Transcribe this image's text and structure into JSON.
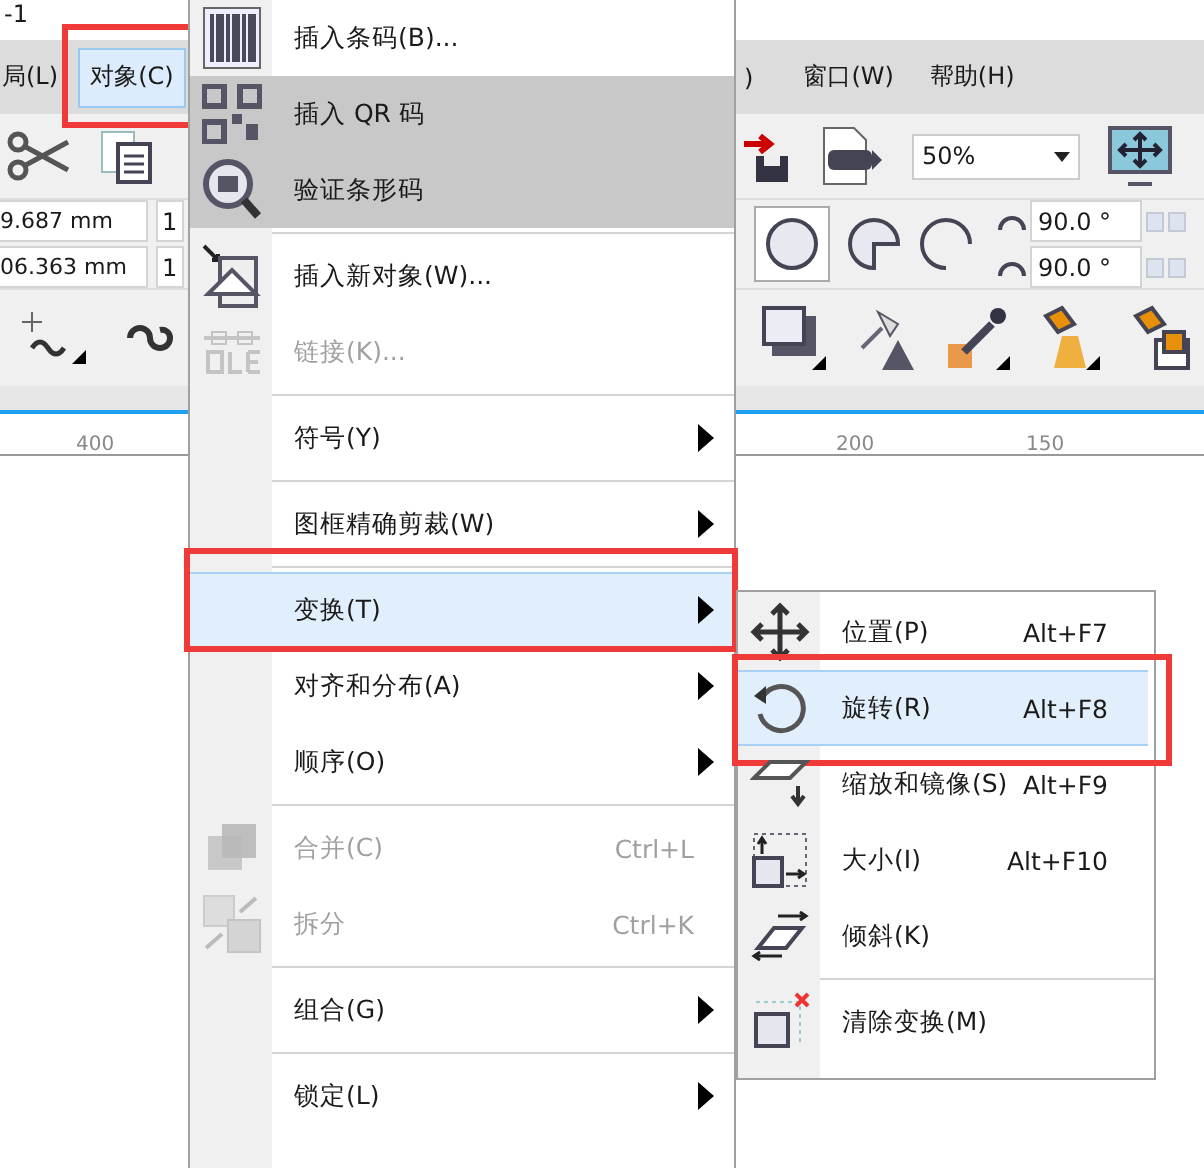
{
  "window": {
    "title": "-1"
  },
  "menubar": {
    "left": [
      {
        "label": "局(L)",
        "selected": false,
        "marked": false
      },
      {
        "label": "对象(C)",
        "selected": true,
        "marked": true
      }
    ],
    "right": [
      {
        "label": ")",
        "selected": false,
        "marked": false
      },
      {
        "label": "窗口(W)",
        "selected": false,
        "marked": false
      },
      {
        "label": "帮助(H)",
        "selected": false,
        "marked": false
      }
    ]
  },
  "toolbar": {
    "zoom": "50%"
  },
  "property_bar": {
    "x_field": "9.687 mm",
    "y_field": "06.363 mm",
    "field_3": "1",
    "field_4": "1",
    "angles": [
      "90.0 °",
      "90.0 °"
    ]
  },
  "ruler": {
    "labels": [
      "400",
      "200",
      "150"
    ]
  },
  "menu": {
    "items": [
      {
        "kind": "item",
        "label": "插入条码(B)...",
        "shaded": false,
        "selected": false,
        "disabled": false,
        "marked": false
      },
      {
        "kind": "item",
        "label": "插入 QR 码",
        "shaded": true,
        "selected": false,
        "disabled": false,
        "marked": false
      },
      {
        "kind": "item",
        "label": "验证条形码",
        "shaded": true,
        "selected": false,
        "disabled": false,
        "marked": false
      },
      {
        "kind": "separator"
      },
      {
        "kind": "item",
        "label": "插入新对象(W)...",
        "shaded": false,
        "selected": false,
        "disabled": false,
        "marked": false
      },
      {
        "kind": "item",
        "label": "链接(K)...",
        "shaded": false,
        "selected": false,
        "disabled": true,
        "marked": false
      },
      {
        "kind": "separator"
      },
      {
        "kind": "submenu",
        "label": "符号(Y)",
        "shaded": false,
        "selected": false,
        "disabled": false,
        "marked": false
      },
      {
        "kind": "separator"
      },
      {
        "kind": "submenu",
        "label": "图框精确剪裁(W)",
        "shaded": false,
        "selected": false,
        "disabled": false,
        "marked": false
      },
      {
        "kind": "separator"
      },
      {
        "kind": "submenu",
        "label": "变换(T)",
        "shaded": false,
        "selected": true,
        "disabled": false,
        "marked": true
      },
      {
        "kind": "submenu",
        "label": "对齐和分布(A)",
        "shaded": false,
        "selected": false,
        "disabled": false,
        "marked": false
      },
      {
        "kind": "submenu",
        "label": "顺序(O)",
        "shaded": false,
        "selected": false,
        "disabled": false,
        "marked": false
      },
      {
        "kind": "separator"
      },
      {
        "kind": "item",
        "label": "合并(C)",
        "shortcut": "Ctrl+L",
        "shaded": false,
        "selected": false,
        "disabled": true,
        "marked": false
      },
      {
        "kind": "item",
        "label": "拆分",
        "shortcut": "Ctrl+K",
        "shaded": false,
        "selected": false,
        "disabled": true,
        "marked": false
      },
      {
        "kind": "separator"
      },
      {
        "kind": "submenu",
        "label": "组合(G)",
        "shaded": false,
        "selected": false,
        "disabled": false,
        "marked": false
      },
      {
        "kind": "separator"
      },
      {
        "kind": "submenu",
        "label": "锁定(L)",
        "shaded": false,
        "selected": false,
        "disabled": false,
        "marked": false
      }
    ]
  },
  "submenu": {
    "items": [
      {
        "kind": "item",
        "label": "位置(P)",
        "shortcut": "Alt+F7",
        "selected": false,
        "marked": false
      },
      {
        "kind": "item",
        "label": "旋转(R)",
        "shortcut": "Alt+F8",
        "selected": true,
        "marked": true
      },
      {
        "kind": "item",
        "label": "缩放和镜像(S)",
        "shortcut": "Alt+F9",
        "selected": false,
        "marked": false
      },
      {
        "kind": "item",
        "label": "大小(I)",
        "shortcut": "Alt+F10",
        "selected": false,
        "marked": false
      },
      {
        "kind": "item",
        "label": "倾斜(K)",
        "selected": false,
        "marked": false
      },
      {
        "kind": "separator"
      },
      {
        "kind": "item",
        "label": "清除变换(M)",
        "selected": false,
        "marked": false
      }
    ]
  }
}
